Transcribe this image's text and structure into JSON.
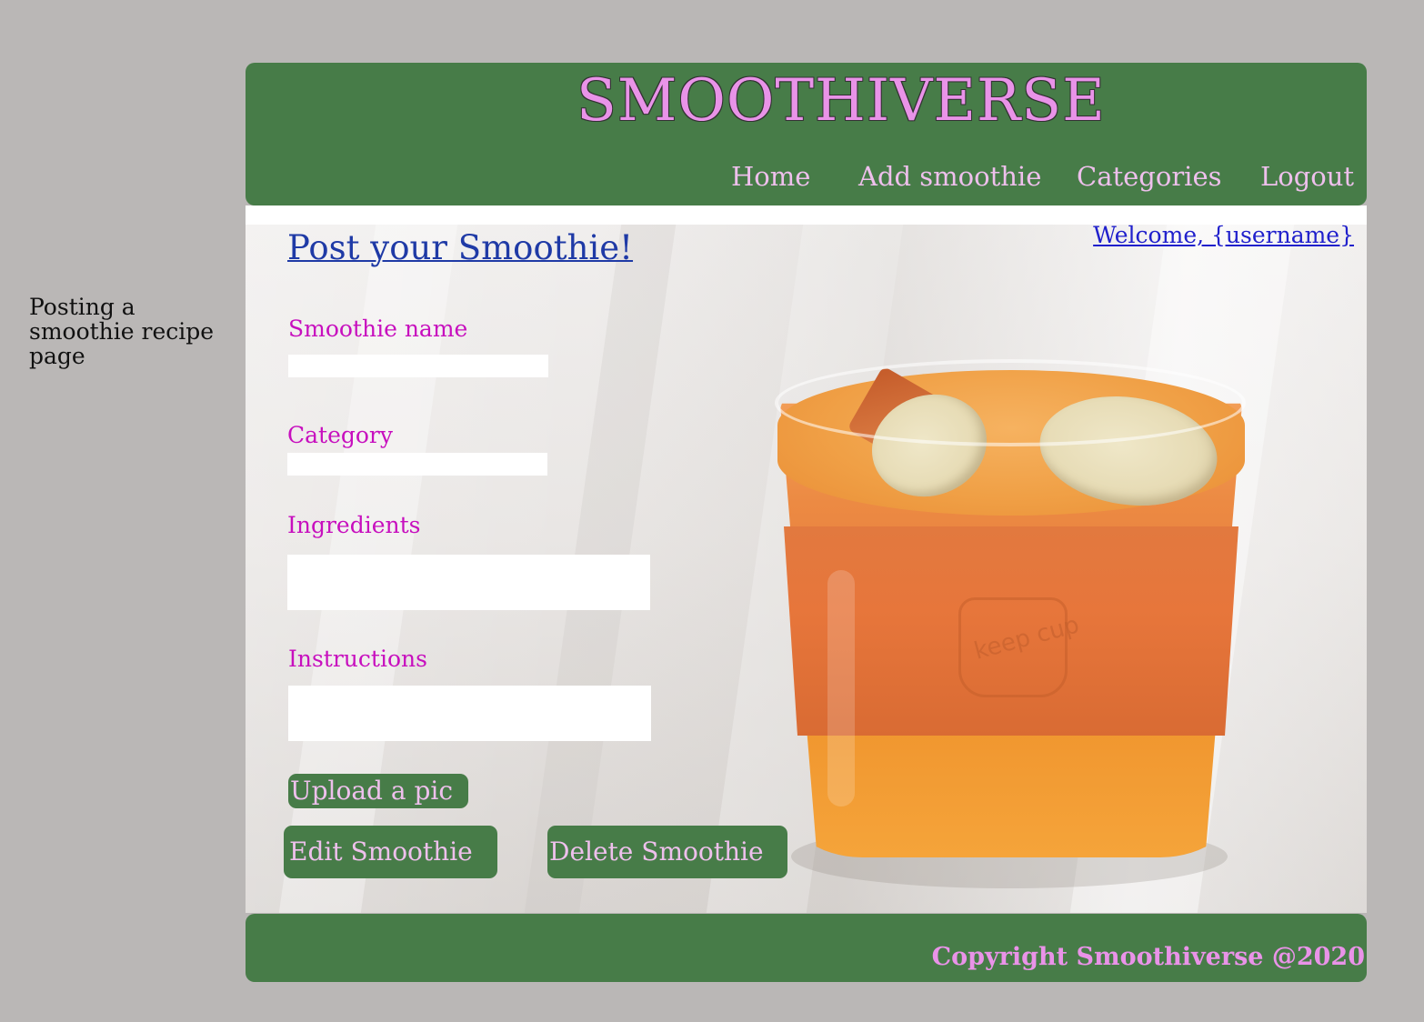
{
  "annotation": {
    "text": "Posting a smoothie recipe page"
  },
  "header": {
    "brand": "SMOOTHIVERSE",
    "nav": [
      {
        "label": "Home"
      },
      {
        "label": "Add smoothie"
      },
      {
        "label": "Categories"
      },
      {
        "label": "Logout"
      }
    ]
  },
  "main": {
    "title": "Post your Smoothie!",
    "welcome": "Welcome, {username}",
    "photo_brand_text": "keep cup",
    "form": {
      "name_label": "Smoothie name",
      "name_value": "",
      "category_label": "Category",
      "category_value": "",
      "ingredients_label": "Ingredients",
      "ingredients_value": "",
      "instructions_label": "Instructions",
      "instructions_value": ""
    },
    "buttons": {
      "upload": "Upload a pic",
      "edit": "Edit Smoothie",
      "delete": "Delete Smoothie"
    }
  },
  "footer": {
    "copyright": "Copyright Smoothiverse @2020"
  },
  "colors": {
    "page_background": "#bab7b6",
    "brand_green": "#477c48",
    "brand_pink": "#e993e8",
    "label_magenta": "#c70fbe",
    "link_blue": "#2020cc"
  }
}
